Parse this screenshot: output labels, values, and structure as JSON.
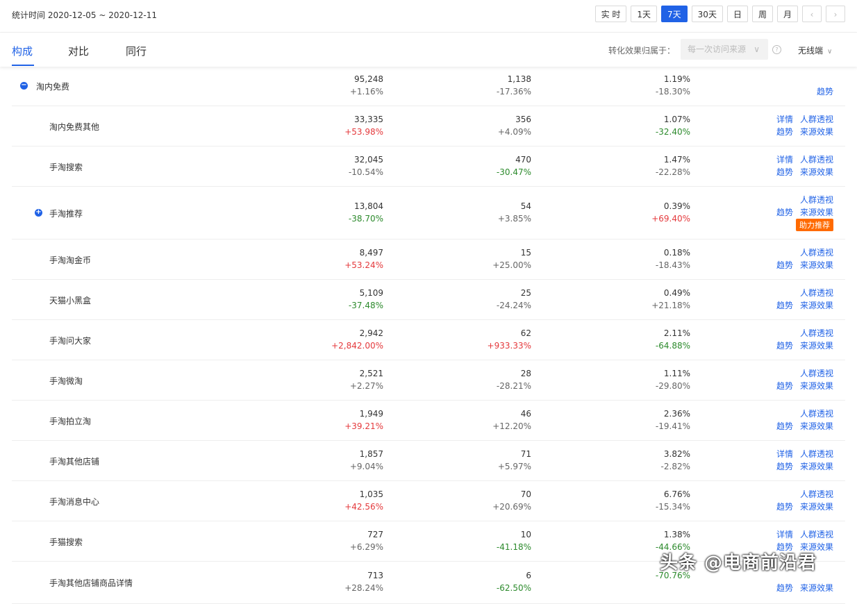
{
  "header": {
    "stat_time": "统计时间 2020-12-05 ~ 2020-12-11",
    "ranges": [
      "实 时",
      "1天",
      "7天",
      "30天",
      "日",
      "周",
      "月"
    ],
    "active_range": "7天",
    "prev_icon": "chevron-left-icon",
    "next_icon": "chevron-right-icon"
  },
  "tabs": [
    {
      "label": "构成",
      "active": true
    },
    {
      "label": "对比",
      "active": false
    },
    {
      "label": "同行",
      "active": false
    }
  ],
  "attribution": {
    "label": "转化效果归属于：",
    "select_value": "每一次访问来源",
    "device": "无线端"
  },
  "colors": {
    "accent": "#2062e6",
    "up": "#e4393c",
    "down": "#2c8a2c",
    "badge": "#ff6a00"
  },
  "rows": [
    {
      "name": "淘内免费",
      "toggle": "−",
      "v1": "95,248",
      "c1": "+1.16%",
      "v2": "1,138",
      "c2": "-17.36%",
      "v3": "1.19%",
      "c3": "-18.30%",
      "ops1": [],
      "ops2": [
        "趋势"
      ]
    },
    {
      "name": "淘内免费其他",
      "v1": "33,335",
      "c1": "+53.98%",
      "v2": "356",
      "c2": "+4.09%",
      "v3": "1.07%",
      "c3": "-32.40%",
      "ops1": [
        "详情",
        "人群透视"
      ],
      "ops2": [
        "趋势",
        "来源效果"
      ]
    },
    {
      "name": "手淘搜索",
      "v1": "32,045",
      "c1": "-10.54%",
      "v2": "470",
      "c2": "-30.47%",
      "v3": "1.47%",
      "c3": "-22.28%",
      "ops1": [
        "详情",
        "人群透视"
      ],
      "ops2": [
        "趋势",
        "来源效果"
      ]
    },
    {
      "name": "手淘推荐",
      "toggle": "+",
      "v1": "13,804",
      "c1": "-38.70%",
      "v2": "54",
      "c2": "+3.85%",
      "v3": "0.39%",
      "c3": "+69.40%",
      "ops1": [
        "人群透视"
      ],
      "ops2": [
        "趋势",
        "来源效果"
      ],
      "badge": "助力推荐"
    },
    {
      "name": "手淘淘金币",
      "v1": "8,497",
      "c1": "+53.24%",
      "v2": "15",
      "c2": "+25.00%",
      "v3": "0.18%",
      "c3": "-18.43%",
      "ops1": [
        "人群透视"
      ],
      "ops2": [
        "趋势",
        "来源效果"
      ]
    },
    {
      "name": "天猫小黑盒",
      "v1": "5,109",
      "c1": "-37.48%",
      "v2": "25",
      "c2": "-24.24%",
      "v3": "0.49%",
      "c3": "+21.18%",
      "ops1": [
        "人群透视"
      ],
      "ops2": [
        "趋势",
        "来源效果"
      ]
    },
    {
      "name": "手淘问大家",
      "v1": "2,942",
      "c1": "+2,842.00%",
      "v2": "62",
      "c2": "+933.33%",
      "v3": "2.11%",
      "c3": "-64.88%",
      "ops1": [
        "人群透视"
      ],
      "ops2": [
        "趋势",
        "来源效果"
      ]
    },
    {
      "name": "手淘微淘",
      "v1": "2,521",
      "c1": "+2.27%",
      "v2": "28",
      "c2": "-28.21%",
      "v3": "1.11%",
      "c3": "-29.80%",
      "ops1": [
        "人群透视"
      ],
      "ops2": [
        "趋势",
        "来源效果"
      ]
    },
    {
      "name": "手淘拍立淘",
      "v1": "1,949",
      "c1": "+39.21%",
      "v2": "46",
      "c2": "+12.20%",
      "v3": "2.36%",
      "c3": "-19.41%",
      "ops1": [
        "人群透视"
      ],
      "ops2": [
        "趋势",
        "来源效果"
      ]
    },
    {
      "name": "手淘其他店铺",
      "v1": "1,857",
      "c1": "+9.04%",
      "v2": "71",
      "c2": "+5.97%",
      "v3": "3.82%",
      "c3": "-2.82%",
      "ops1": [
        "详情",
        "人群透视"
      ],
      "ops2": [
        "趋势",
        "来源效果"
      ]
    },
    {
      "name": "手淘消息中心",
      "v1": "1,035",
      "c1": "+42.56%",
      "v2": "70",
      "c2": "+20.69%",
      "v3": "6.76%",
      "c3": "-15.34%",
      "ops1": [
        "人群透视"
      ],
      "ops2": [
        "趋势",
        "来源效果"
      ]
    },
    {
      "name": "手猫搜索",
      "v1": "727",
      "c1": "+6.29%",
      "v2": "10",
      "c2": "-41.18%",
      "v3": "1.38%",
      "c3": "-44.66%",
      "ops1": [
        "详情",
        "人群透视"
      ],
      "ops2": [
        "趋势",
        "来源效果"
      ]
    },
    {
      "name": "手淘其他店铺商品详情",
      "v1": "713",
      "c1": "+28.24%",
      "v2": "6",
      "c2": "-62.50%",
      "v3": "",
      "c3": "-70.76%",
      "ops1": [],
      "ops2": [
        "趋势",
        "来源效果"
      ]
    }
  ],
  "watermark": "头条 @电商前沿君"
}
